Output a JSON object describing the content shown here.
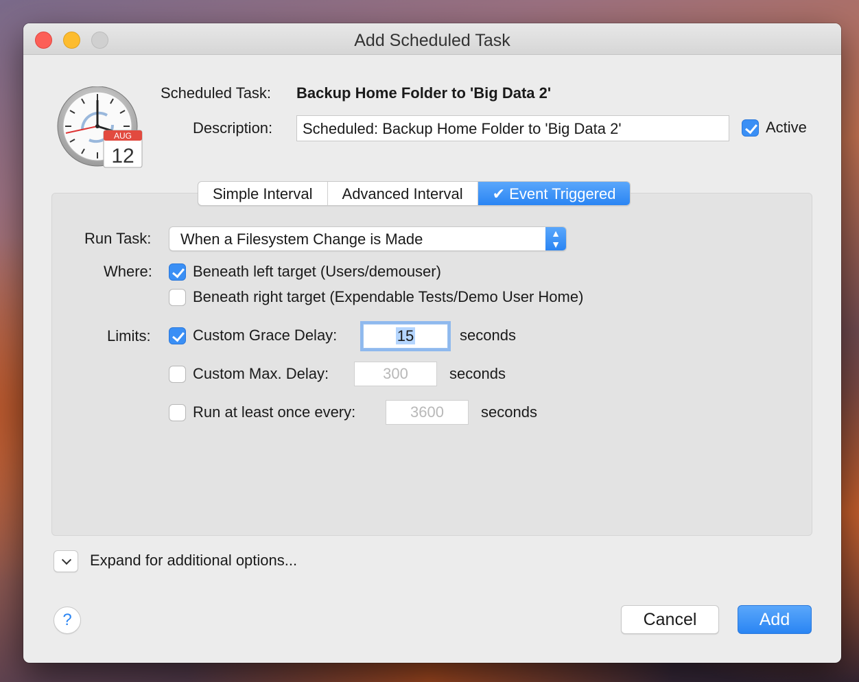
{
  "window": {
    "title": "Add Scheduled Task",
    "app_icon": "clock-calendar-icon",
    "calendar_month": "AUG",
    "calendar_day": "12"
  },
  "header": {
    "task_label": "Scheduled Task:",
    "task_name": "Backup Home Folder to 'Big Data 2'",
    "description_label": "Description:",
    "description_value": "Scheduled: Backup Home Folder to 'Big Data 2'",
    "active_label": "Active",
    "active_checked": true
  },
  "tabs": [
    {
      "label": "Simple Interval",
      "active": false
    },
    {
      "label": "Advanced Interval",
      "active": false
    },
    {
      "label": "✔ Event Triggered",
      "active": true
    }
  ],
  "trigger": {
    "run_task_label": "Run Task:",
    "run_task_value": "When a Filesystem Change is Made",
    "where_label": "Where:",
    "where_left": "Beneath left target (Users/demouser)",
    "where_left_checked": true,
    "where_right": "Beneath right target (Expendable Tests/Demo User Home)",
    "where_right_checked": false,
    "limits_label": "Limits:",
    "grace_label": "Custom Grace Delay:",
    "grace_value": "15",
    "grace_checked": true,
    "max_label": "Custom Max. Delay:",
    "max_value": "300",
    "max_checked": false,
    "once_label": "Run at least once every:",
    "once_value": "3600",
    "once_checked": false,
    "unit": "seconds"
  },
  "footer": {
    "expand_label": "Expand for additional options...",
    "help_label": "?",
    "cancel_label": "Cancel",
    "add_label": "Add"
  },
  "colors": {
    "accent": "#2a85f3",
    "close": "#fc5f57",
    "minimize": "#fdbc2e",
    "zoom_disabled": "#d0d0d0"
  }
}
